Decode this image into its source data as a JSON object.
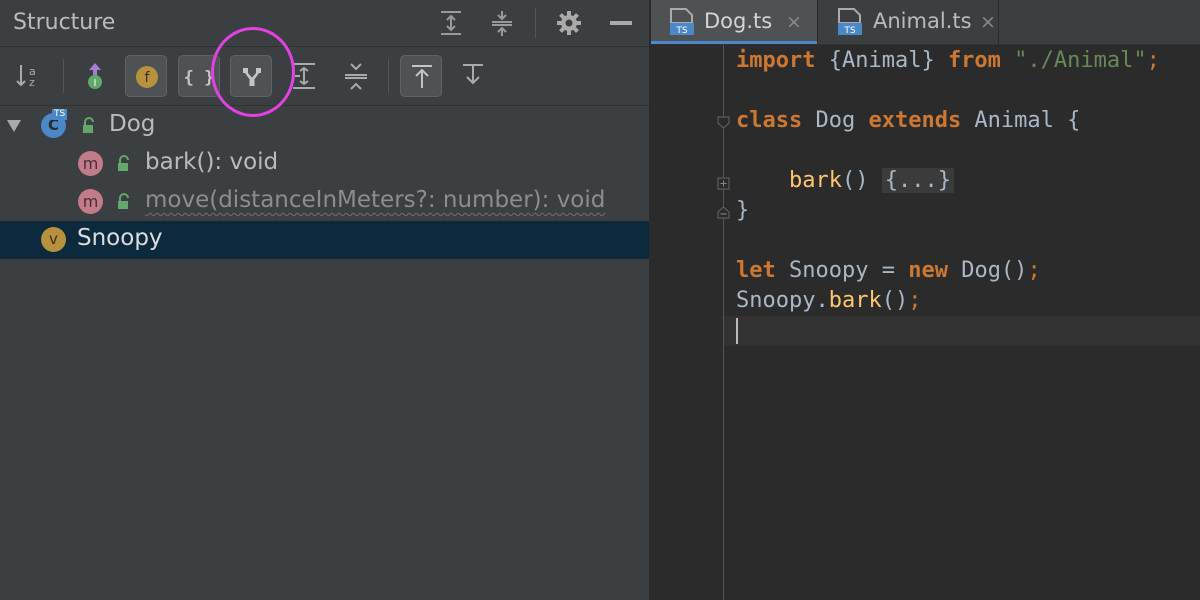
{
  "structure": {
    "title": "Structure",
    "header_icons": [
      "expand-all-icon",
      "collapse-all-icon",
      "gear-icon",
      "minimize-icon"
    ],
    "toolbar_icons": [
      "sort-alphabetically-icon",
      "show-inherited-icon",
      "show-fields-icon",
      "show-object-literals-icon",
      "group-by-type-icon",
      "expand-icon",
      "collapse-icon",
      "autoscroll-to-source-icon",
      "autoscroll-from-source-icon"
    ],
    "toolbar_labels": {
      "fields": "f",
      "literals": "{ }"
    },
    "tree": [
      {
        "label": "Dog",
        "kind": "class",
        "badge": "C",
        "ts_badge": "TS",
        "expanded": true
      },
      {
        "label": "bark(): void",
        "kind": "method",
        "badge": "m"
      },
      {
        "label": "move(distanceInMeters?: number): void",
        "kind": "method",
        "badge": "m",
        "inherited": true
      },
      {
        "label": "Snoopy",
        "kind": "variable",
        "badge": "v",
        "selected": true
      }
    ]
  },
  "editor": {
    "tabs": [
      {
        "label": "Dog.ts",
        "icon_text": "TS",
        "active": true
      },
      {
        "label": "Animal.ts",
        "icon_text": "TS",
        "active": false
      }
    ],
    "close_glyph": "×",
    "code": {
      "import_kw": "import",
      "import_name": " {Animal} ",
      "from_kw": "from",
      "import_path": "\"./Animal\"",
      "semi": ";",
      "class_kw": "class",
      "class_name": " Dog ",
      "extends_kw": "extends",
      "class_rest": " Animal {",
      "method_name": "bark",
      "method_args": "() ",
      "folded": "{...}",
      "close_brace": "}",
      "let_kw": "let",
      "let_name": " Snoopy = ",
      "new_kw": "new",
      "new_call": " Dog()",
      "call_obj": "Snoopy.",
      "call_method": "bark",
      "call_args": "()"
    }
  },
  "colors": {
    "keyword": "#cc7832",
    "string": "#6a8759",
    "function": "#ffc66d",
    "selection": "#0d293e",
    "highlight_ring": "#e142e1"
  }
}
